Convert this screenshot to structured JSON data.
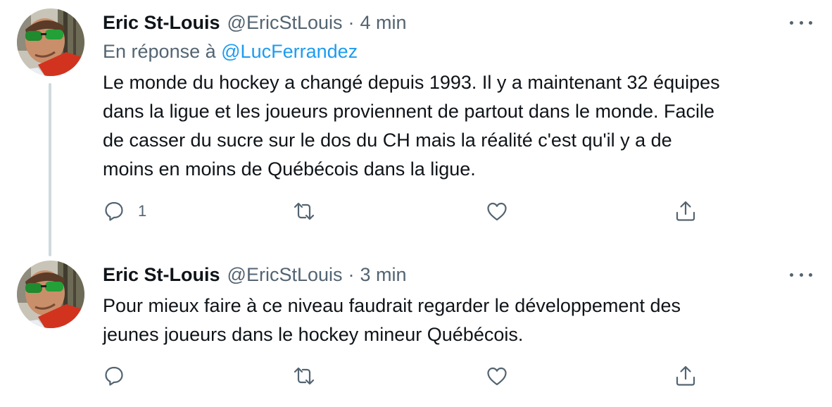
{
  "tweets": [
    {
      "author_name": "Eric St-Louis",
      "handle": "@EricStLouis",
      "separator": "·",
      "time": "4 min",
      "reply_prefix": "En réponse à",
      "reply_mention": "@LucFerrandez",
      "lines": [
        "Le monde du hockey a changé depuis 1993. Il y a maintenant 32 équipes",
        "dans la ligue et les joueurs proviennent de partout dans le monde. Facile",
        "de casser du sucre sur le dos du CH mais la réalité c'est qu'il y a de",
        "moins en moins de Québécois dans la ligue."
      ],
      "reply_count": "1"
    },
    {
      "author_name": "Eric St-Louis",
      "handle": "@EricStLouis",
      "separator": "·",
      "time": "3 min",
      "lines": [
        "Pour mieux faire à ce niveau faudrait regarder le développement des",
        "jeunes joueurs dans le hockey mineur Québécois."
      ]
    }
  ],
  "icons": {
    "reply": "reply-icon",
    "retweet": "retweet-icon",
    "like": "like-icon",
    "share": "share-icon",
    "more": "more-options-icon"
  },
  "colors": {
    "text": "#0f1419",
    "secondary": "#536471",
    "link": "#1d9bf0",
    "thread_line": "#cfd9de"
  }
}
